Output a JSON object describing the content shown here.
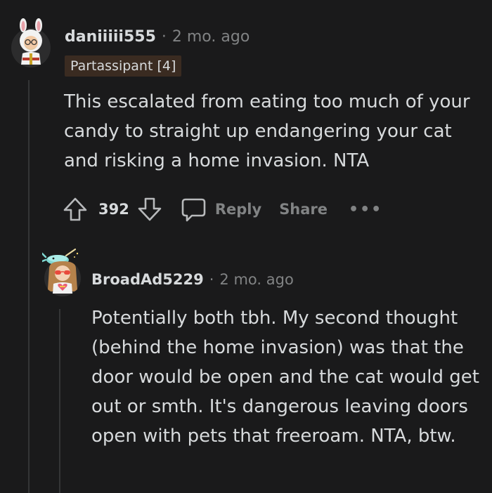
{
  "comment": {
    "username": "daniiiii555",
    "separator": "·",
    "time": "2 mo. ago",
    "flair": "Partassipant [4]",
    "body": "This escalated from eating too much of your candy to straight up endangering your cat and risking a home invasion. NTA",
    "score": "392",
    "reply_label": "Reply",
    "share_label": "Share",
    "more_label": "•••"
  },
  "reply": {
    "username": "BroadAd5229",
    "separator": "·",
    "time": "2 mo. ago",
    "body": "Potentially both tbh. My second thought (behind the home invasion) was that the door would be open and the cat would get out or smth. It's dangerous leaving doors open with pets that freeroam. NTA, btw."
  },
  "colors": {
    "background": "#1a1a1b",
    "text": "#d7dadc",
    "muted": "#818384",
    "flair_bg": "#3a2b21",
    "thread_line": "#343536"
  },
  "icons": {
    "upvote": "arrow-up-icon",
    "downvote": "arrow-down-icon",
    "reply": "speech-bubble-icon",
    "more": "ellipsis-icon"
  }
}
